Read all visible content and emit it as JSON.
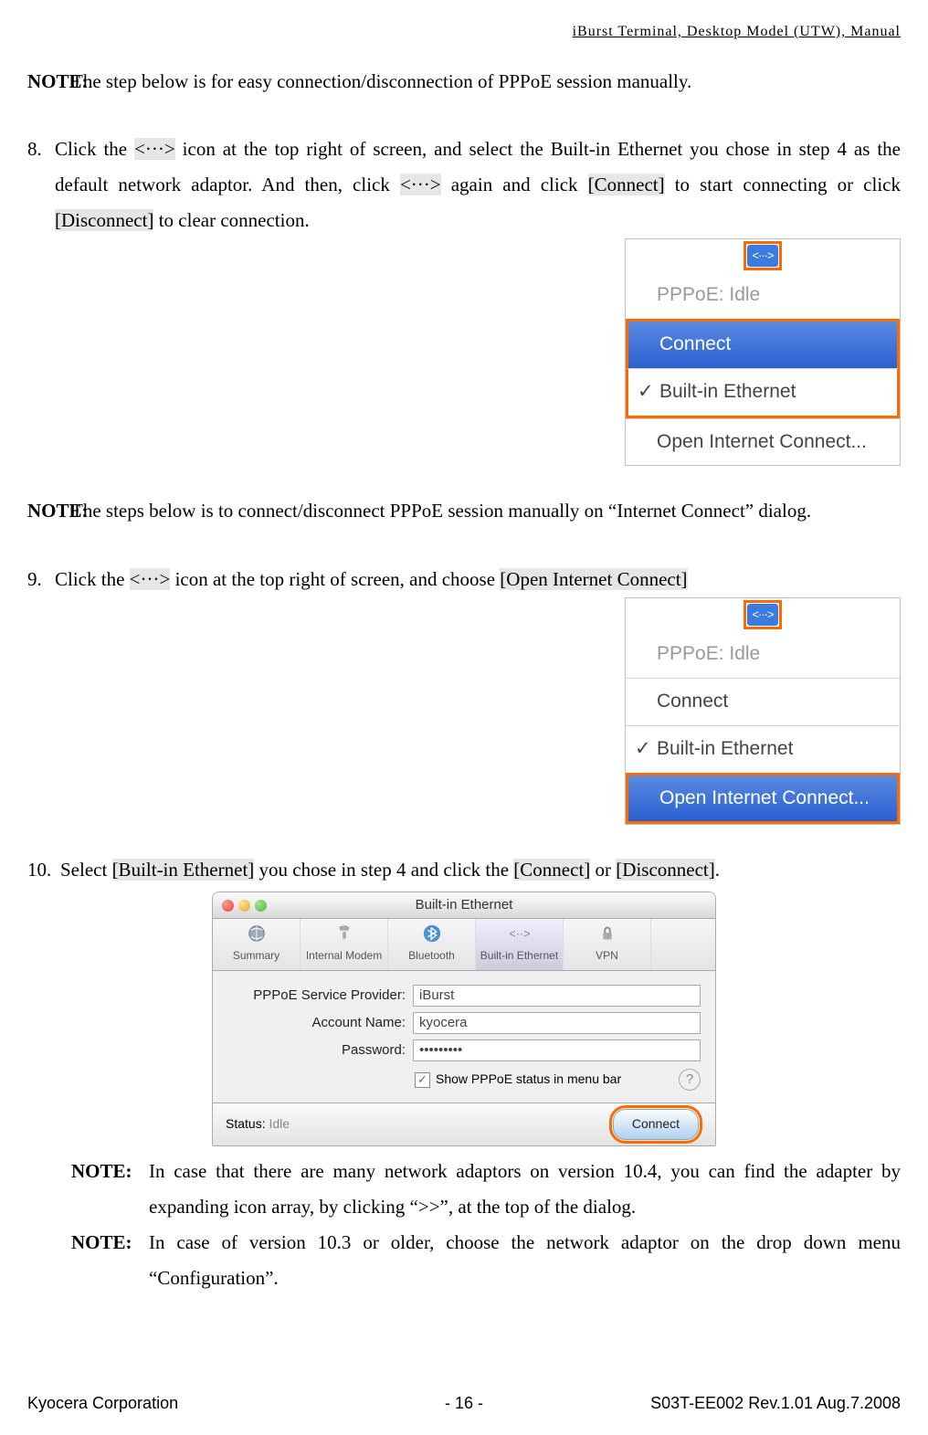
{
  "header": "iBurst  Terminal,  Desktop  Model  (UTW),  Manual",
  "note_lbl": "NOTE:",
  "note1_text": "The step below is for easy connection/disconnection of PPPoE session manually.",
  "step8": {
    "num": "8.",
    "pre1": "Click the ",
    "hl1": "<···>",
    "mid1": " icon at the top right of screen, and select the Built-in Ethernet you chose in step 4 as the default network adaptor.  And then, click ",
    "hl2": "<···>",
    "mid2": " again and click ",
    "hl3": "[Connect]",
    "mid3": " to start connecting or click ",
    "hl4": "[Disconnect]",
    "mid4": " to clear connection."
  },
  "menu1": {
    "idle": "PPPoE: Idle",
    "connect": "Connect",
    "builtin": "Built-in Ethernet",
    "open": "Open Internet Connect..."
  },
  "note2_text": "The steps below is to connect/disconnect PPPoE session manually on “Internet Connect” dialog.",
  "step9": {
    "num": "9.",
    "pre1": "Click the ",
    "hl1": "<···>",
    "mid1": " icon at the top right of screen, and choose ",
    "hl2": "[Open Internet Connect]"
  },
  "step10": {
    "num": "10.",
    "pre1": "Select ",
    "hl1": "[Built-in Ethernet]",
    "mid1": " you chose in step 4 and click the ",
    "hl2": "[Connect]",
    "mid2": " or ",
    "hl3": "[Disconnect]",
    "mid3": "."
  },
  "macwin": {
    "title": "Built-in Ethernet",
    "tb": {
      "summary": "Summary",
      "modem": "Internal Modem",
      "bt": "Bluetooth",
      "eth": "Built-in Ethernet",
      "vpn": "VPN"
    },
    "f_provider_l": "PPPoE Service Provider:",
    "f_provider_v": "iBurst",
    "f_account_l": "Account Name:",
    "f_account_v": "kyocera",
    "f_password_l": "Password:",
    "f_password_v": "•••••••••",
    "chk_lbl": "Show PPPoE status in menu bar",
    "status_l": "Status:",
    "status_v": "Idle",
    "connect": "Connect"
  },
  "note3_text": "In case that there are many network adaptors on version 10.4, you can find the adapter by expanding icon array, by clicking “>>”, at the top of the dialog.",
  "note4_text": "In case of version 10.3 or older, choose the network adaptor on the drop down menu “Configuration”.",
  "footer": {
    "left": "Kyocera Corporation",
    "mid": "- 16 -",
    "right": "S03T-EE002 Rev.1.01 Aug.7.2008"
  },
  "icons": {
    "arrows": "<···>"
  }
}
